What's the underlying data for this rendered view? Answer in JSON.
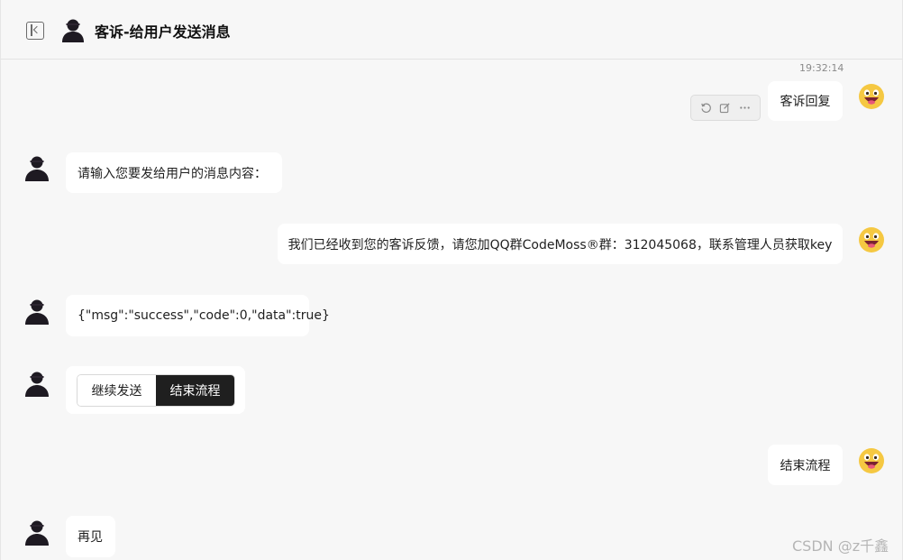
{
  "header": {
    "title": "客诉-给用户发送消息"
  },
  "messages": {
    "m1": {
      "timestamp": "19:32:14",
      "text": "客诉回复"
    },
    "m2": {
      "text": "请输入您要发给用户的消息内容："
    },
    "m3": {
      "text": "我们已经收到您的客诉反馈，请您加QQ群CodeMoss®群：312045068，联系管理人员获取key"
    },
    "m4": {
      "text": "{\"msg\":\"success\",\"code\":0,\"data\":true}"
    },
    "m5": {
      "options": {
        "continue": "继续发送",
        "end": "结束流程"
      }
    },
    "m6": {
      "text": "结束流程"
    },
    "m7": {
      "text": "再见"
    }
  },
  "watermark": "CSDN @z千鑫",
  "colors": {
    "background": "#f7f7f7",
    "bubble": "#ffffff",
    "primary_button": "#1f1f1f",
    "user_avatar": "#f5c842"
  }
}
